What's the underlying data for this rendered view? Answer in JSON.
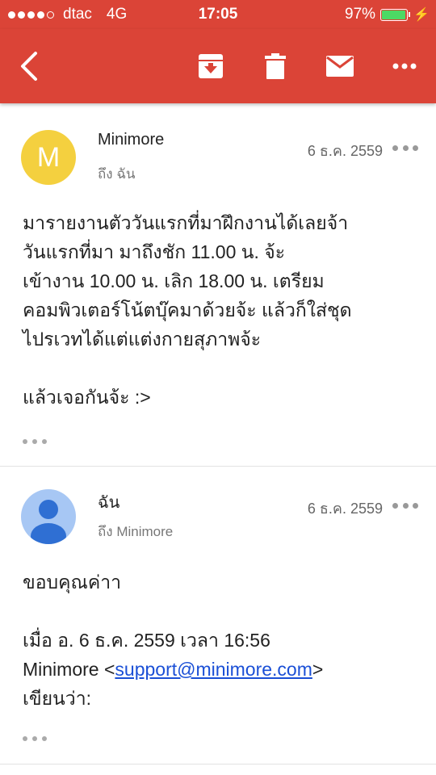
{
  "status_bar": {
    "carrier": "dtac",
    "network": "4G",
    "time": "17:05",
    "battery_percent_text": "97%",
    "battery_level": 0.97,
    "battery_color": "#4cd964"
  },
  "toolbar": {
    "color": "#db4437",
    "back_icon": "chevron-left-icon",
    "archive_icon": "archive-icon",
    "delete_icon": "trash-icon",
    "mail_icon": "envelope-icon",
    "more_icon": "more-horizontal-icon"
  },
  "messages": [
    {
      "avatar_letter": "M",
      "avatar_color": "#f4d03f",
      "sender": "Minimore",
      "to": "ถึง ฉัน",
      "date": "6 ธ.ค. 2559",
      "body_lines": [
        "มารายงานตัววันแรกที่มาฝึกงานได้เลยจ้า",
        "วันแรกที่มา มาถึงชัก 11.00 น. จ้ะ",
        "เข้างาน 10.00 น. เลิก 18.00 น. เตรียม",
        "คอมพิวเตอร์โน้ตบุ๊คมาด้วยจ้ะ แล้วก็ใส่ชุด",
        "ไปรเวทได้แต่แต่งกายสุภาพจ้ะ"
      ],
      "closing": "แล้วเจอกันจ้ะ :>"
    },
    {
      "avatar_color": "#a7c7f4",
      "sender": "ฉัน",
      "to": "ถึง Minimore",
      "date": "6 ธ.ค. 2559",
      "body_first": "ขอบคุณค่าา",
      "quote_line1": "เมื่อ อ. 6 ธ.ค. 2559 เวลา 16:56",
      "quote_name": "Minimore <",
      "quote_email": "support@minimore.com",
      "quote_end": ">",
      "quote_line3": "เขียนว่า:"
    }
  ]
}
